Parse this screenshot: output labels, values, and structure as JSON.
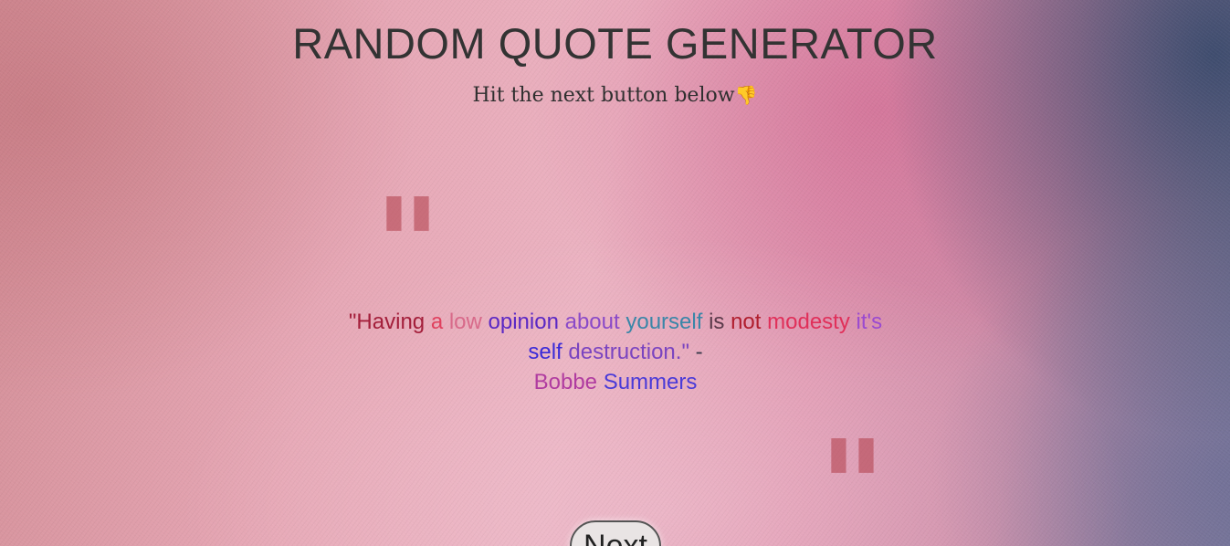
{
  "header": {
    "title": "RANDOM QUOTE GENERATOR",
    "subtitle": "Hit the next button below",
    "subtitle_icon": "👎"
  },
  "decor": {
    "open_quote": "\"",
    "close_quote": "\""
  },
  "quote": {
    "words": [
      {
        "text": "\"Having",
        "color": "#a31e3a"
      },
      {
        "text": "a",
        "color": "#e0415e"
      },
      {
        "text": "low",
        "color": "#d86a8a"
      },
      {
        "text": "opinion",
        "color": "#5a28c4"
      },
      {
        "text": "about",
        "color": "#8a4ac8"
      },
      {
        "text": "yourself",
        "color": "#3a86a8"
      },
      {
        "text": "is",
        "color": "#5a3a4a"
      },
      {
        "text": "not",
        "color": "#b01e2e"
      },
      {
        "text": "modesty",
        "color": "#e0305a"
      },
      {
        "text": "it's",
        "color": "#9a4ad0"
      },
      {
        "text": "self",
        "color": "#3a2ad8"
      },
      {
        "text": "destruction.\"",
        "color": "#7a44c0"
      },
      {
        "text": "-",
        "color": "#3a3a4a"
      }
    ],
    "author_words": [
      {
        "text": "Bobbe",
        "color": "#b03ca0"
      },
      {
        "text": "Summers",
        "color": "#4a3ad8"
      }
    ]
  },
  "controls": {
    "next_label": "Next"
  },
  "colors": {
    "title": "#333333",
    "quote_mark": "#b44450"
  }
}
